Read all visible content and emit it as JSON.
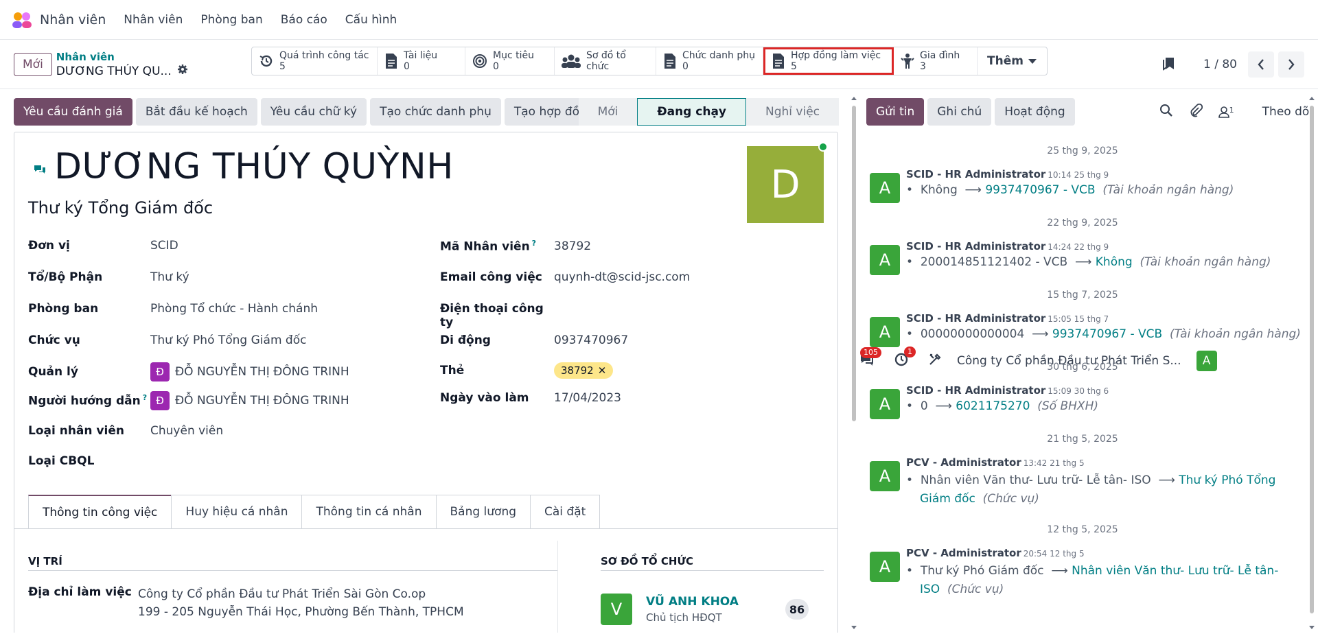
{
  "topnav": {
    "app_name": "Nhân viên",
    "menus": [
      "Nhân viên",
      "Phòng ban",
      "Báo cáo",
      "Cấu hình"
    ],
    "messages_badge": "105",
    "activities_badge": "1",
    "company": "Công ty Cổ phần Đầu tư Phát Triển S...",
    "user_initial": "A"
  },
  "control_panel": {
    "new_label": "Mới",
    "breadcrumb_parent": "Nhân viên",
    "breadcrumb_current": "DƯƠNG THÚY QU...",
    "pager_text": "1 / 80",
    "more_label": "Thêm"
  },
  "smart_buttons": [
    {
      "label": "Quá trình công tác",
      "count": "5",
      "icon": "history-icon"
    },
    {
      "label": "Tài liệu",
      "count": "0",
      "icon": "document-icon"
    },
    {
      "label": "Mục tiêu",
      "count": "0",
      "icon": "target-icon"
    },
    {
      "label": "Sơ đồ tổ chức",
      "count": "",
      "icon": "org-chart-icon"
    },
    {
      "label": "Chức danh phụ",
      "count": "0",
      "icon": "document-icon"
    },
    {
      "label": "Hợp đồng làm việc",
      "count": "5",
      "icon": "contract-icon"
    },
    {
      "label": "Gia đình",
      "count": "3",
      "icon": "family-icon"
    }
  ],
  "actions": [
    "Yêu cầu đánh giá",
    "Bắt đầu kế hoạch",
    "Yêu cầu chữ ký",
    "Tạo chức danh phụ",
    "Tạo hợp đồng"
  ],
  "statusbar": [
    "Mới",
    "Đang chạy",
    "Nghỉ việc"
  ],
  "employee": {
    "name": "DƯƠNG THÚY QUỲNH",
    "job_title": "Thư ký Tổng Giám đốc",
    "photo_initial": "D",
    "left_fields": [
      {
        "label": "Đơn vị",
        "value": "SCID"
      },
      {
        "label": "Tổ/Bộ Phận",
        "value": "Thư ký"
      },
      {
        "label": "Phòng ban",
        "value": "Phòng Tổ chức - Hành chánh"
      },
      {
        "label": "Chức vụ",
        "value": "Thư ký Phó Tổng Giám đốc"
      },
      {
        "label": "Quản lý",
        "value": "ĐỖ NGUYỄN THỊ ĐÔNG TRINH",
        "avatar": "Đ"
      },
      {
        "label": "Người hướng dẫn",
        "value": "ĐỖ NGUYỄN THỊ ĐÔNG TRINH",
        "avatar": "Đ"
      },
      {
        "label": "Loại nhân viên",
        "value": "Chuyên viên"
      },
      {
        "label": "Loại CBQL",
        "value": ""
      }
    ],
    "right_fields": [
      {
        "label": "Mã Nhân viên",
        "value": "38792"
      },
      {
        "label": "Email công việc",
        "value": "quynh-dt@scid-jsc.com"
      },
      {
        "label": "Điện thoại công ty",
        "value": ""
      },
      {
        "label": "Di động",
        "value": "0937470967"
      },
      {
        "label": "Thẻ",
        "value": "38792"
      },
      {
        "label": "Ngày vào làm",
        "value": "17/04/2023"
      }
    ]
  },
  "tabs": [
    "Thông tin công việc",
    "Huy hiệu cá nhân",
    "Thông tin cá nhân",
    "Bảng lương",
    "Cài đặt"
  ],
  "work_info": {
    "section_title": "VỊ TRÍ",
    "address_label": "Địa chỉ làm việc",
    "address_line1": "Công ty Cổ phần Đầu tư Phát Triển Sài Gòn Co.op",
    "address_line2": "199 - 205 Nguyễn Thái Học, Phường Bến Thành, TPHCM",
    "org_title": "SƠ ĐỒ TỔ CHỨC",
    "org_person_initial": "V",
    "org_person_name": "VŨ ANH KHOA",
    "org_person_title": "Chủ tịch HĐQT",
    "org_count": "86"
  },
  "chatter": {
    "send_label": "Gửi tin",
    "note_label": "Ghi chú",
    "activity_label": "Hoạt động",
    "followers_count": "1",
    "follow_label": "Theo dõi",
    "feed": [
      {
        "date": "25 thg 9, 2025",
        "author": "SCID - HR Administrator",
        "time": "10:14 25 thg 9",
        "old": "Không",
        "new": "9937470967 - VCB",
        "field": "(Tài khoản ngân hàng)"
      },
      {
        "date": "22 thg 9, 2025",
        "author": "SCID - HR Administrator",
        "time": "14:24 22 thg 9",
        "old": "200014851121402 - VCB",
        "new": "Không",
        "field": "(Tài khoản ngân hàng)"
      },
      {
        "date": "15 thg 7, 2025",
        "author": "SCID - HR Administrator",
        "time": "15:05 15 thg 7",
        "old": "00000000000004",
        "new": "9937470967 - VCB",
        "field": "(Tài khoản ngân hàng)"
      },
      {
        "date": "30 thg 6, 2025",
        "author": "SCID - HR Administrator",
        "time": "15:09 30 thg 6",
        "old": "0",
        "new": "6021175270",
        "field": "(Số BHXH)"
      },
      {
        "date": "21 thg 5, 2025",
        "author": "PCV - Administrator",
        "time": "13:42 21 thg 5",
        "old": "Nhân viên Văn thư- Lưu trữ- Lễ tân- ISO",
        "new": "Thư ký Phó Tổng Giám đốc",
        "field": "(Chức vụ)"
      },
      {
        "date": "12 thg 5, 2025",
        "author": "PCV - Administrator",
        "time": "20:54 12 thg 5",
        "old": "Thư ký Phó Giám đốc",
        "new": "Nhân viên Văn thư- Lưu trữ- Lễ tân- ISO",
        "field": "(Chức vụ)"
      }
    ]
  },
  "colors": {
    "primary": "#714B67",
    "accent": "#017e84",
    "highlight_box": "#dc2626"
  }
}
